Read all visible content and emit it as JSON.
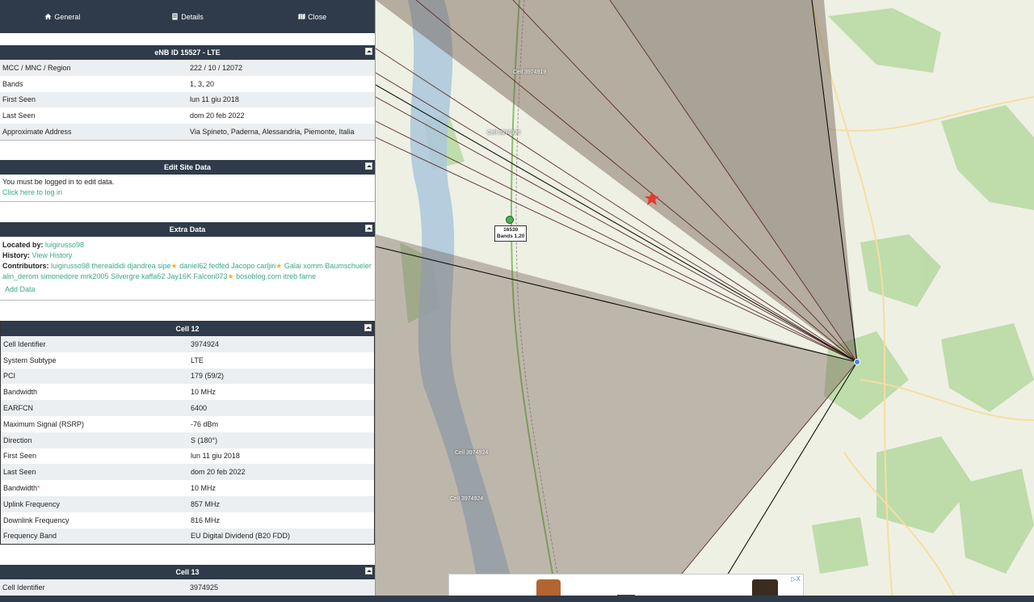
{
  "nav": {
    "general": "General",
    "details": "Details",
    "close": "Close"
  },
  "enb": {
    "title": "eNB ID 15527 - LTE",
    "rows": [
      {
        "k": "MCC / MNC / Region",
        "v": "222 / 10 / 12072"
      },
      {
        "k": "Bands",
        "v": "1, 3, 20"
      },
      {
        "k": "First Seen",
        "v": "lun 11 giu 2018"
      },
      {
        "k": "Last Seen",
        "v": "dom 20 feb 2022"
      },
      {
        "k": "Approximate Address",
        "v": "Via Spineto, Paderna, Alessandria, Piemonte, Italia"
      }
    ]
  },
  "edit": {
    "title": "Edit Site Data",
    "msg": "You must be logged in to edit data.",
    "login": "Click here to log in"
  },
  "extra": {
    "title": "Extra Data",
    "located_label": "Located by:",
    "located_by": "luigirusso98",
    "history_label": "History:",
    "history_link": "View History",
    "contrib_label": "Contributors:",
    "contrib_part1": "luigirusso98 therealdidi djandrea sipe",
    "contrib_part2": " daniel62 fedfed Jacopo carljiri",
    "contrib_part3": " Galai xomm Baumschueler",
    "contrib_part4": "alin_derom simonedore mrk2005 Silvergre kaffa62 Jay16K Falcon073",
    "contrib_part5": " bosoblog.com itreb farne",
    "add_data": "Add Data"
  },
  "cell12": {
    "title": "Cell 12",
    "rows": [
      {
        "k": "Cell Identifier",
        "v": "3974924"
      },
      {
        "k": "System Subtype",
        "v": "LTE"
      },
      {
        "k": "PCI",
        "v": "179 (59/2)"
      },
      {
        "k": "Bandwidth",
        "v": "10 MHz"
      },
      {
        "k": "EARFCN",
        "v": "6400"
      },
      {
        "k": "Maximum Signal (RSRP)",
        "v": "-76 dBm"
      },
      {
        "k": "Direction",
        "v": "S (180°)"
      },
      {
        "k": "First Seen",
        "v": "lun 11 giu 2018"
      },
      {
        "k": "Last Seen",
        "v": "dom 20 feb 2022"
      },
      {
        "k": "Bandwidth",
        "v": "10 MHz",
        "req": "*"
      },
      {
        "k": "Uplink Frequency",
        "v": "857 MHz"
      },
      {
        "k": "Downlink Frequency",
        "v": "816 MHz"
      },
      {
        "k": "Frequency Band",
        "v": "EU Digital Dividend (B20 FDD)"
      }
    ]
  },
  "cell13": {
    "title": "Cell 13",
    "rows": [
      {
        "k": "Cell Identifier",
        "v": "3974925"
      }
    ]
  },
  "map": {
    "labels": [
      "Cell 3974919",
      "Cell 3974925",
      "Cell 3974924",
      "Cell 3974924"
    ],
    "tower_id": "16530",
    "tower_bands": "Bands 1,20"
  },
  "ad": {
    "close": "▷X"
  },
  "colors": {
    "header": "#2f3b4a",
    "link": "#3aa88a",
    "star": "#f3b62a",
    "marker": "#e53b2c"
  }
}
